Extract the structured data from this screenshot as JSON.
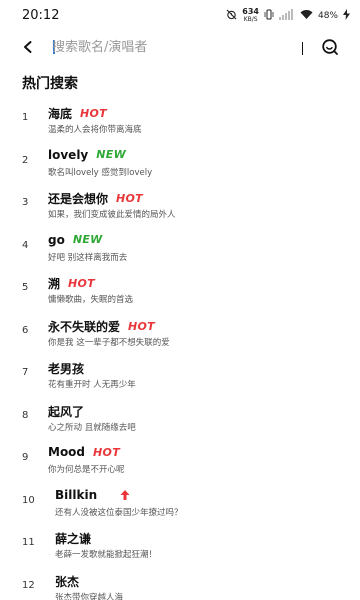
{
  "status_bar": {
    "time": "20:12",
    "net_speed_value": "634",
    "net_speed_unit": "KB/S",
    "battery_percent": "48%"
  },
  "search": {
    "placeholder": "搜索歌名/演唱者"
  },
  "section_title": "热门搜索",
  "colors": {
    "hot": "#e8363a",
    "new": "#2ea836",
    "caret": "#2a7bd8"
  },
  "hot_list": [
    {
      "rank": "1",
      "title": "海底",
      "badge": "HOT",
      "badge_type": "hot",
      "subtitle": "温柔的人会将你带离海底"
    },
    {
      "rank": "2",
      "title": "lovely",
      "badge": "NEW",
      "badge_type": "new",
      "subtitle": "歌名叫lovely 感觉到lovely"
    },
    {
      "rank": "3",
      "title": "还是会想你",
      "badge": "HOT",
      "badge_type": "hot",
      "subtitle": "如果，我们变成彼此爱情的局外人"
    },
    {
      "rank": "4",
      "title": "go",
      "badge": "NEW",
      "badge_type": "new",
      "subtitle": "好吧 别这样离我而去"
    },
    {
      "rank": "5",
      "title": "溯",
      "badge": "HOT",
      "badge_type": "hot",
      "subtitle": "慵懒歌曲，失眠的首选"
    },
    {
      "rank": "6",
      "title": "永不失联的爱",
      "badge": "HOT",
      "badge_type": "hot",
      "subtitle": "你是我 这一辈子都不想失联的爱"
    },
    {
      "rank": "7",
      "title": "老男孩",
      "badge": "",
      "badge_type": "none",
      "subtitle": "花有重开时 人无再少年"
    },
    {
      "rank": "8",
      "title": "起风了",
      "badge": "",
      "badge_type": "none",
      "subtitle": "心之所动 且就随缘去吧"
    },
    {
      "rank": "9",
      "title": "Mood",
      "badge": "HOT",
      "badge_type": "hot",
      "subtitle": "你为何总是不开心呢"
    },
    {
      "rank": "10",
      "title": "Billkin",
      "badge": "",
      "badge_type": "up",
      "subtitle": "还有人没被这位泰国少年撩过吗？"
    },
    {
      "rank": "11",
      "title": "薛之谦",
      "badge": "",
      "badge_type": "none",
      "subtitle": "老薛一发歌就能掀起狂潮！"
    },
    {
      "rank": "12",
      "title": "张杰",
      "badge": "",
      "badge_type": "none",
      "subtitle": "张杰带你穿越人海"
    }
  ]
}
